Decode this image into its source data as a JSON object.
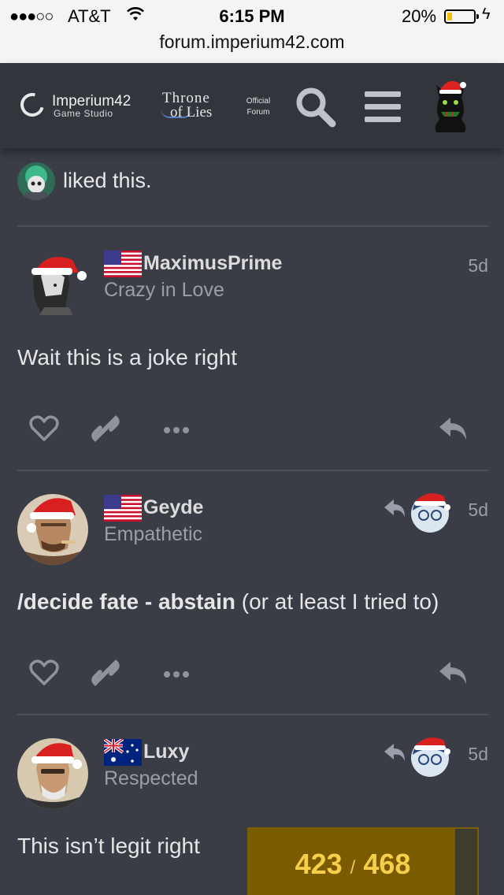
{
  "ios": {
    "carrier": "AT&T",
    "time": "6:15 PM",
    "battery_pct": "20%",
    "battery_level": 0.2,
    "url": "forum.imperium42.com"
  },
  "header": {
    "studio_name": "Imperium42",
    "studio_sub": "Game Studio",
    "game_line1": "Throne",
    "game_line2": "of Lies",
    "official_line1": "Official",
    "official_line2": "Forum"
  },
  "likes_text": "liked this.",
  "posts": [
    {
      "username": "MaximusPrime",
      "user_title": "Crazy in Love",
      "date": "5d",
      "flag": "us",
      "body": "Wait this is a joke right",
      "reply_to": false
    },
    {
      "username": "Geyde",
      "user_title": "Empathetic",
      "date": "5d",
      "flag": "us",
      "body_bold": "/decide fate - abstain",
      "body_rest": " (or at least I tried to)",
      "reply_to": true
    },
    {
      "username": "Luxy",
      "user_title": "Respected",
      "date": "5d",
      "flag": "au",
      "body": "This isn’t legit right",
      "reply_to": true
    }
  ],
  "progress": {
    "current": "423",
    "separator": "/",
    "total": "468",
    "fraction": 0.904
  },
  "colors": {
    "background": "#3a3d46",
    "header": "#32353c",
    "muted_text": "#9a9ea8",
    "progress_fill": "#7b5b00",
    "progress_text": "#f6cf4a"
  }
}
